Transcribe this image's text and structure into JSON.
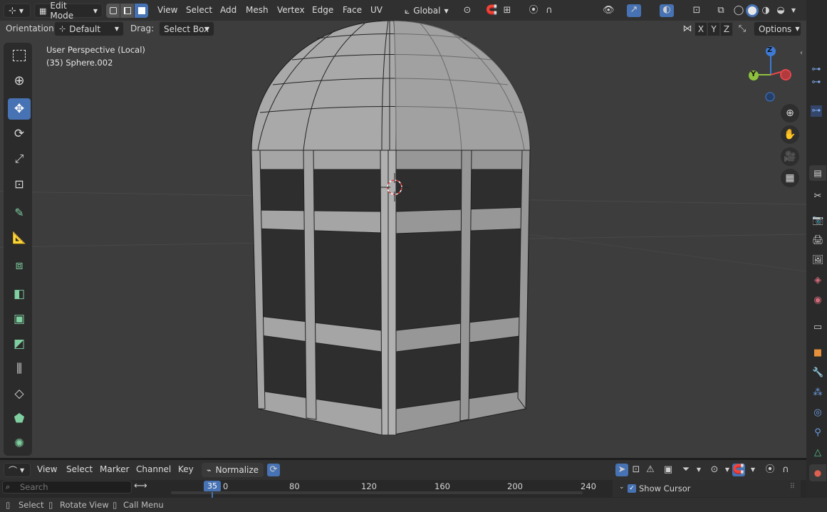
{
  "header": {
    "mode_label": "Edit Mode",
    "menus": [
      "View",
      "Select",
      "Add",
      "Mesh",
      "Vertex",
      "Edge",
      "Face",
      "UV"
    ],
    "transform_orientation": "Global",
    "options_label": "Options"
  },
  "toolheader": {
    "orientation_label": "Orientation:",
    "orientation_value": "Default",
    "drag_label": "Drag:",
    "drag_value": "Select Box",
    "axis_x": "X",
    "axis_y": "Y",
    "axis_z": "Z"
  },
  "viewport": {
    "perspective_text": "User Perspective (Local)",
    "object_text": "(35) Sphere.002",
    "gizmo": {
      "x": "X",
      "y": "Y",
      "z": "Z"
    }
  },
  "timeline": {
    "menus": [
      "View",
      "Select",
      "Marker",
      "Channel",
      "Key"
    ],
    "normalize_label": "Normalize",
    "search_placeholder": "Search",
    "current_frame": "35",
    "ticks": [
      "0",
      "80",
      "120",
      "160",
      "200",
      "240"
    ],
    "show_cursor_label": "Show Cursor"
  },
  "statusbar": {
    "select": "Select",
    "rotate_view": "Rotate View",
    "call_menu": "Call Menu"
  },
  "colors": {
    "accent": "#4772b3",
    "axis_x": "#e8474b",
    "axis_y": "#8ec23e",
    "axis_z": "#3d7bd6"
  }
}
